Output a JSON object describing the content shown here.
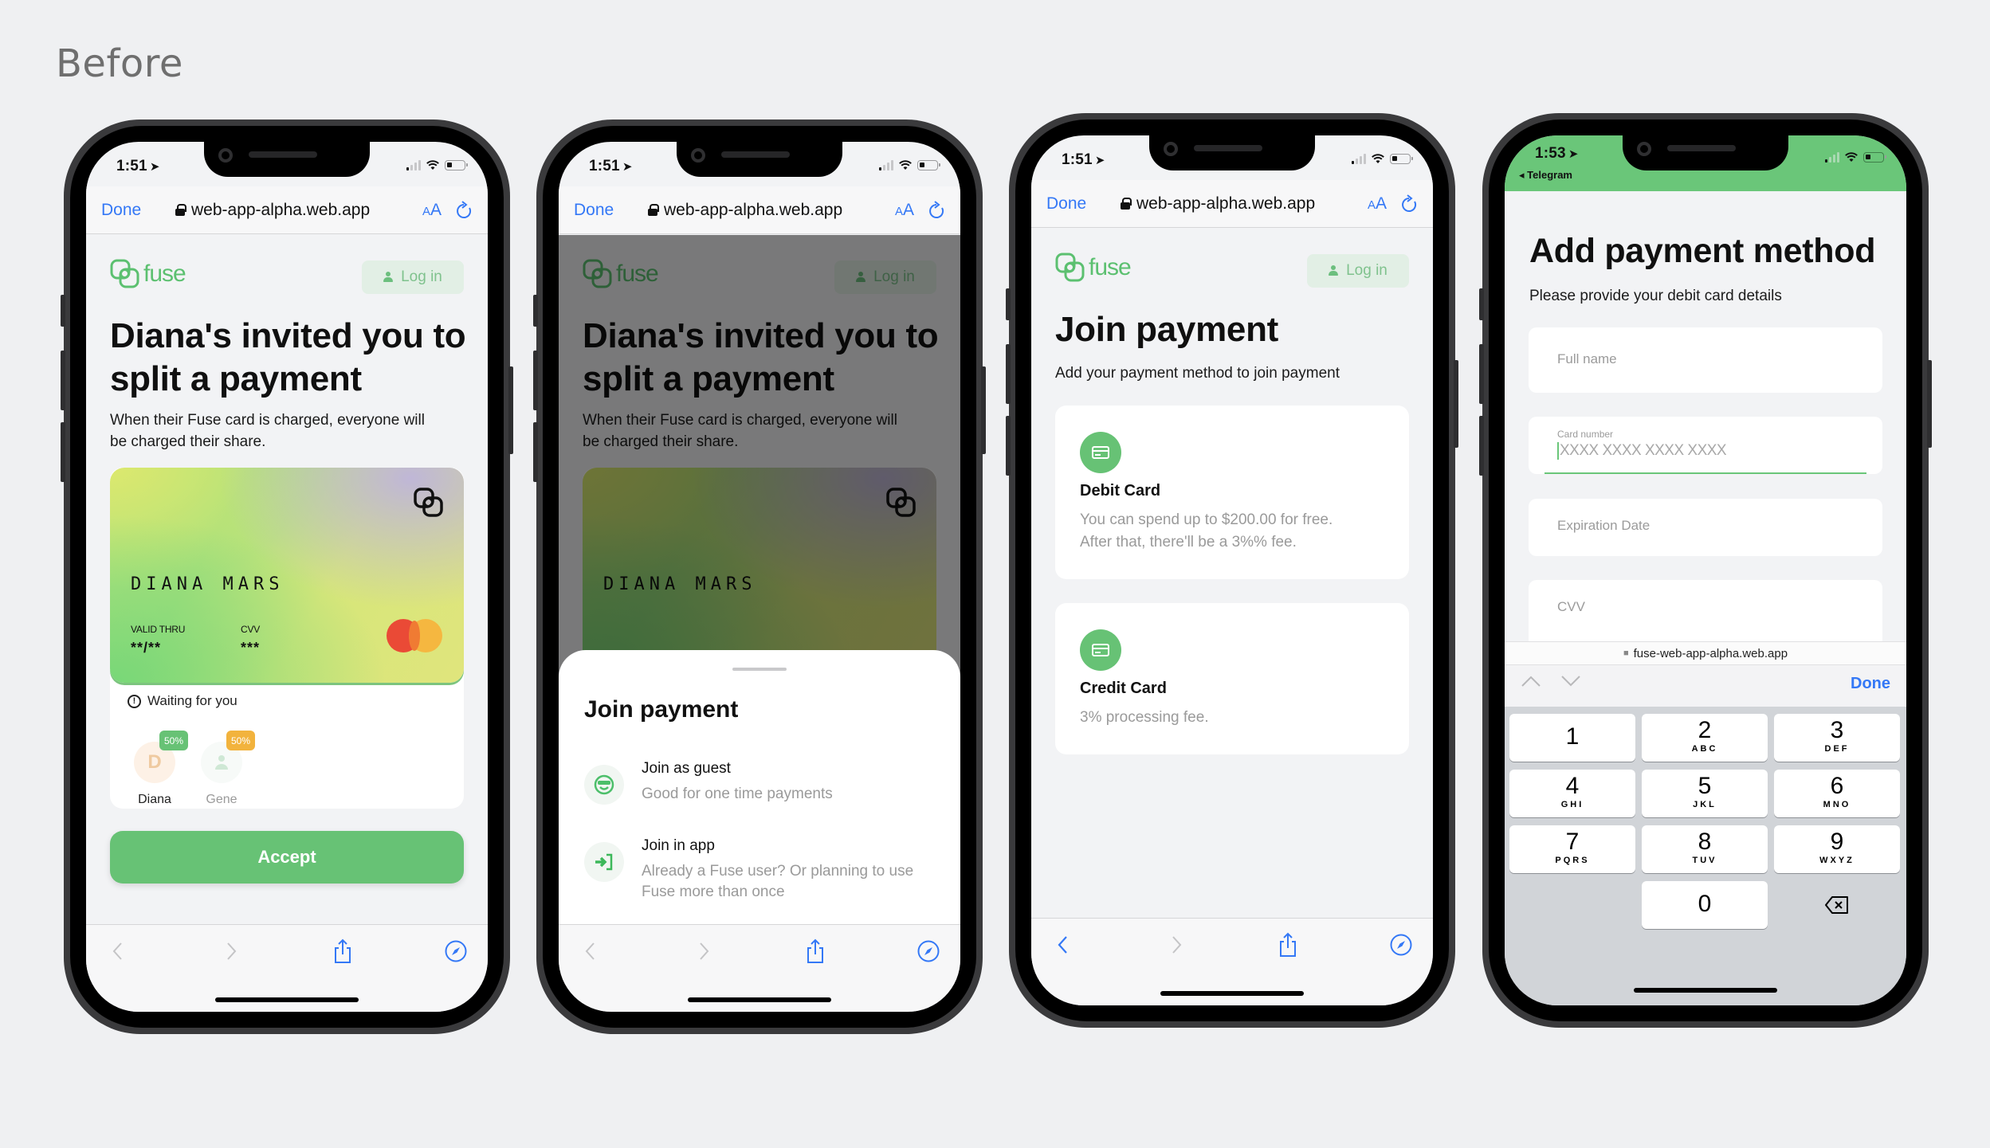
{
  "heading": "Before",
  "colors": {
    "brand_green": "#67c275",
    "ios_blue": "#3478f6",
    "badge_green": "#67c275",
    "badge_orange": "#f2b33d",
    "page_bg": "#eff0f2"
  },
  "phones": [
    {
      "status": {
        "time": "1:51",
        "location_icon": "location-arrow-icon"
      },
      "urlbar": {
        "done": "Done",
        "url": "web-app-alpha.web.app",
        "aa_small": "A",
        "aa_large": "A"
      },
      "header": {
        "logo": "fuse",
        "login": "Log in"
      },
      "title_line1": "Diana's invited you to",
      "title_line2": "split a payment",
      "subtitle_line1": "When their Fuse card is charged, everyone will",
      "subtitle_line2": "be charged their share.",
      "card": {
        "holder": "DIANA MARS",
        "valid_thru_label": "VALID THRU",
        "valid_thru_value": "**/**",
        "cvv_label": "CVV",
        "cvv_value": "***"
      },
      "waiting_text": "Waiting for you",
      "members": [
        {
          "initial": "D",
          "name": "Diana",
          "share": "50%"
        },
        {
          "initial": "",
          "name": "Gene",
          "share": "50%"
        }
      ],
      "accept": "Accept"
    },
    {
      "status": {
        "time": "1:51"
      },
      "urlbar": {
        "done": "Done",
        "url": "web-app-alpha.web.app",
        "aa_small": "A",
        "aa_large": "A"
      },
      "header": {
        "logo": "fuse",
        "login": "Log in"
      },
      "title_line1": "Diana's invited you to",
      "title_line2": "split a payment",
      "subtitle_line1": "When their Fuse card is charged, everyone will",
      "subtitle_line2": "be charged their share.",
      "card": {
        "holder": "DIANA MARS"
      },
      "sheet": {
        "title": "Join payment",
        "options": [
          {
            "title": "Join as guest",
            "desc": "Good for one time payments",
            "icon": "sunglasses-smiley-icon"
          },
          {
            "title": "Join in app",
            "desc": "Already a Fuse user? Or planning to use Fuse more than once",
            "icon": "sign-in-arrow-icon"
          }
        ]
      }
    },
    {
      "status": {
        "time": "1:51"
      },
      "urlbar": {
        "done": "Done",
        "url": "web-app-alpha.web.app",
        "aa_small": "A",
        "aa_large": "A"
      },
      "header": {
        "logo": "fuse",
        "login": "Log in"
      },
      "title": "Join payment",
      "subtitle": "Add your payment method to join payment",
      "methods": [
        {
          "title": "Debit Card",
          "desc_line1": "You can spend up to $200.00 for free.",
          "desc_line2": "After that, there'll be a 3%% fee."
        },
        {
          "title": "Credit Card",
          "desc_line1": "3% processing fee.",
          "desc_line2": ""
        }
      ]
    },
    {
      "status": {
        "time": "1:53",
        "back_app": "Telegram"
      },
      "title": "Add payment method",
      "subtitle": "Please provide your debit card details",
      "fields": {
        "full_name": "Full name",
        "card_number_label": "Card number",
        "card_number_placeholder": "XXXX XXXX XXXX XXXX",
        "expiration": "Expiration Date",
        "cvv": "CVV"
      },
      "keyboard_url": "fuse-web-app-alpha.web.app",
      "keyboard_done": "Done",
      "keys": [
        {
          "n": "1",
          "l": ""
        },
        {
          "n": "2",
          "l": "ABC"
        },
        {
          "n": "3",
          "l": "DEF"
        },
        {
          "n": "4",
          "l": "GHI"
        },
        {
          "n": "5",
          "l": "JKL"
        },
        {
          "n": "6",
          "l": "MNO"
        },
        {
          "n": "7",
          "l": "PQRS"
        },
        {
          "n": "8",
          "l": "TUV"
        },
        {
          "n": "9",
          "l": "WXYZ"
        },
        {
          "n": "0",
          "l": ""
        }
      ]
    }
  ]
}
